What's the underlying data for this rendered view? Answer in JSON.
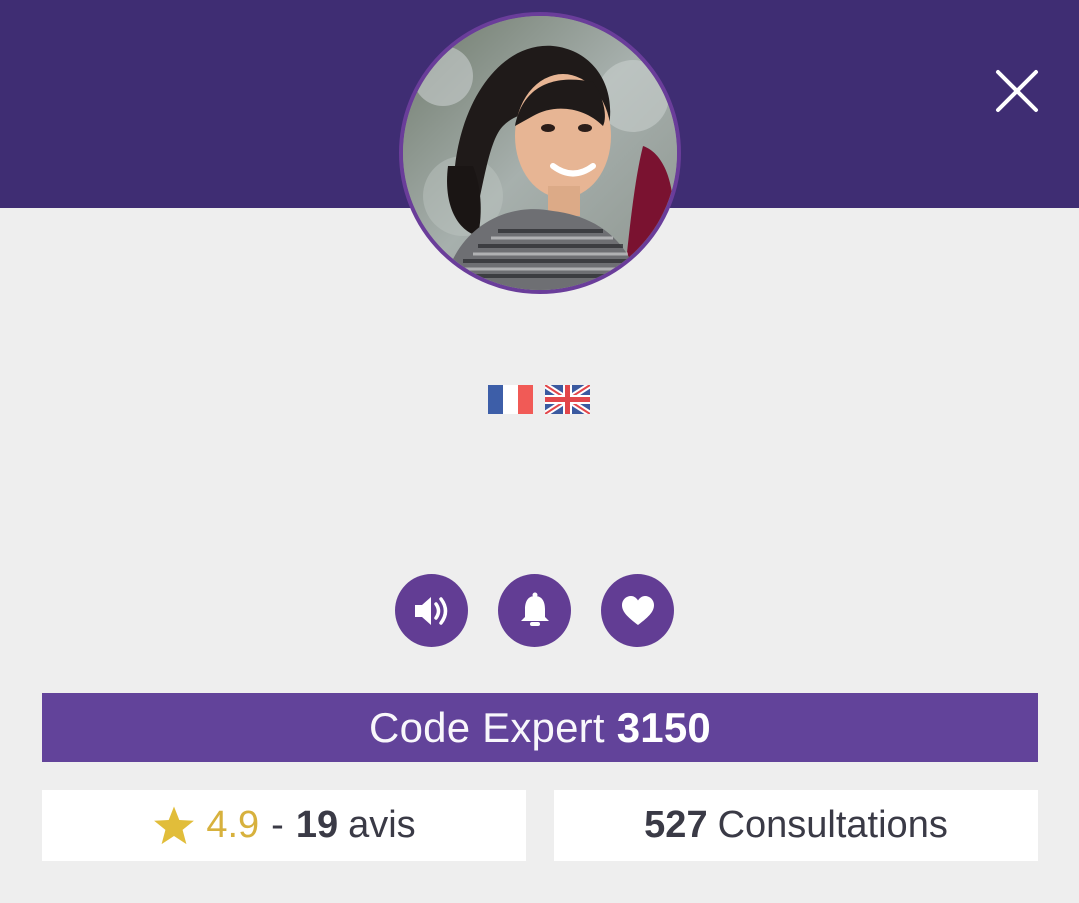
{
  "header": {
    "close_icon": "close-icon",
    "background": "#3f2d73"
  },
  "profile": {
    "avatar_icon": "profile-photo",
    "languages": [
      {
        "icon": "flag-france-icon"
      },
      {
        "icon": "flag-uk-icon"
      }
    ]
  },
  "actions": [
    {
      "icon": "speaker-icon"
    },
    {
      "icon": "bell-icon"
    },
    {
      "icon": "heart-icon"
    }
  ],
  "code": {
    "label": "Code Expert",
    "value": "3150"
  },
  "stats": {
    "rating": {
      "icon": "star-icon",
      "value": "4.9",
      "separator": "-",
      "count": "19",
      "label": "avis"
    },
    "consultations": {
      "count": "527",
      "label": "Consultations"
    }
  },
  "colors": {
    "primary": "#3f2d73",
    "accent": "#623d94",
    "code_bar": "#62439a",
    "star": "#e1bd3a",
    "rating_text": "#d7b13d",
    "background": "#eeeeee"
  }
}
